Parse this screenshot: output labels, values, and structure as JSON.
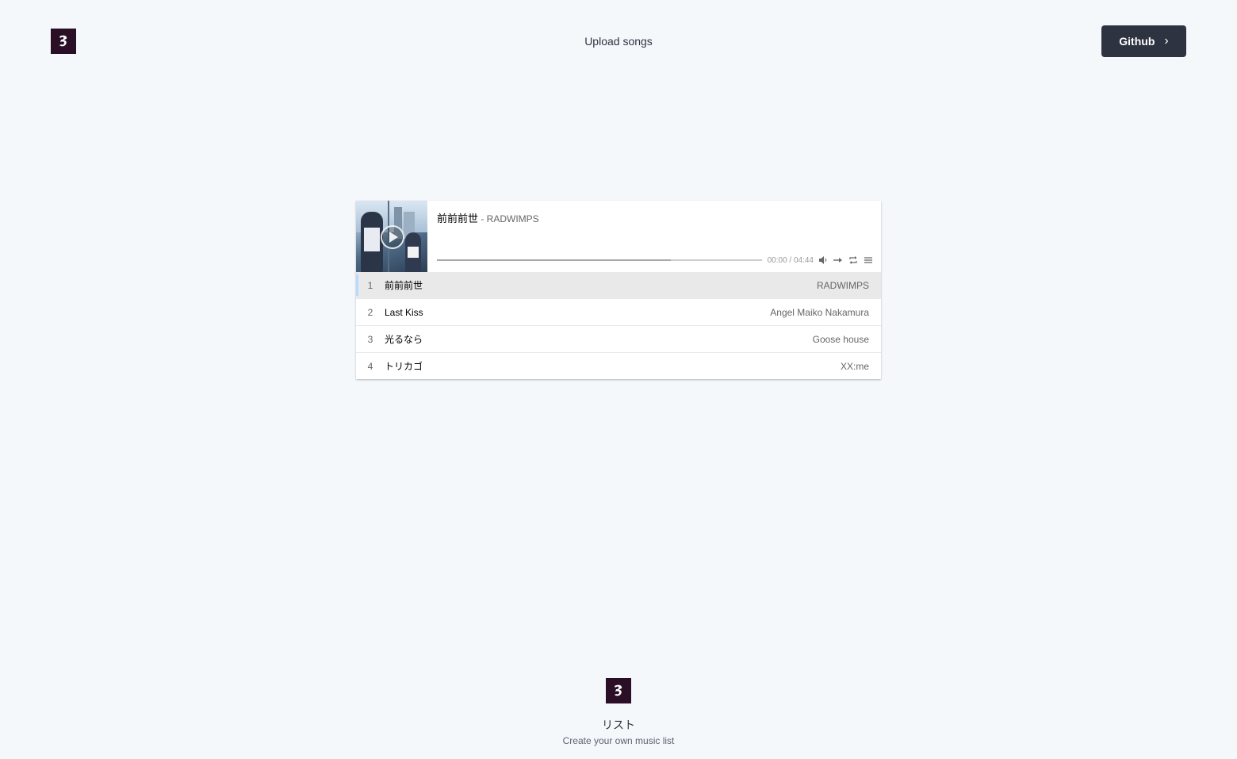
{
  "header": {
    "nav_link": "Upload songs",
    "github_label": "Github"
  },
  "player": {
    "current_title": "前前前世",
    "current_author": " - RADWIMPS",
    "time": "00:00 / 04:44",
    "loaded_fraction": 0.72,
    "playlist": [
      {
        "index": "1",
        "title": "前前前世",
        "author": "RADWIMPS"
      },
      {
        "index": "2",
        "title": "Last Kiss",
        "author": "Angel Maiko Nakamura"
      },
      {
        "index": "3",
        "title": "光るなら",
        "author": "Goose house"
      },
      {
        "index": "4",
        "title": "トリカゴ",
        "author": "XX:me"
      }
    ]
  },
  "footer": {
    "title": "リスト",
    "subtitle": "Create your own music list"
  },
  "colors": {
    "background": "#f5f8fb",
    "logo_bg": "#2a0f26",
    "button_bg": "#2d3340",
    "active_row": "#e9e9e9",
    "active_marker": "#b7daff"
  }
}
